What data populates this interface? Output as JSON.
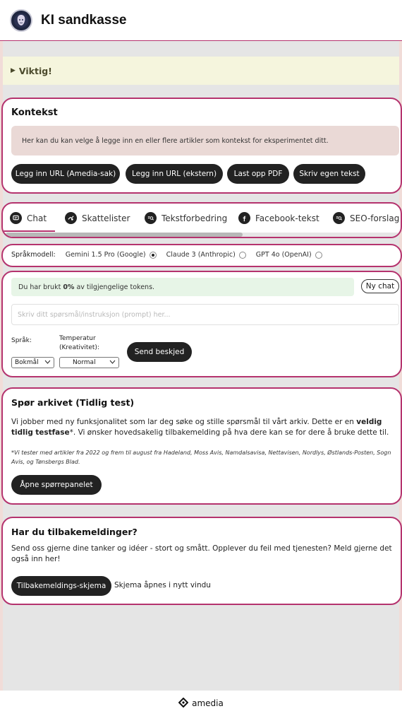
{
  "header": {
    "title": "KI sandkasse"
  },
  "notice": {
    "label": "Viktig!"
  },
  "context": {
    "title": "Kontekst",
    "info": "Her kan du kan velge å legge inn en eller flere artikler som kontekst for eksperimentet ditt.",
    "buttons": [
      "Legg inn URL (Amedia-sak)",
      "Legg inn URL (ekstern)",
      "Last opp PDF",
      "Skriv egen tekst"
    ]
  },
  "tabs": [
    "Chat",
    "Skattelister",
    "Tekstforbedring",
    "Facebook-tekst",
    "SEO-forslag"
  ],
  "model": {
    "label": "Språkmodell:",
    "options": [
      "Gemini 1.5 Pro (Google)",
      "Claude 3 (Anthropic)",
      "GPT 4o (OpenAI)"
    ],
    "selected": "Gemini 1.5 Pro (Google)"
  },
  "chat": {
    "tokens_prefix": "Du har brukt",
    "tokens_value": "0%",
    "tokens_suffix": "av tilgjengelige tokens.",
    "new_chat": "Ny chat",
    "prompt_placeholder": "Skriv ditt spørsmål/instruksjon (prompt) her...",
    "language_label": "Språk:",
    "language_value": "Bokmål",
    "temp_label_1": "Temperatur",
    "temp_label_2": "(Kreativitet):",
    "temp_value": "Normal",
    "send": "Send beskjed"
  },
  "archive": {
    "title": "Spør arkivet (Tidlig test)",
    "text_1": "Vi jobber med ny funksjonalitet som lar deg søke og stille spørsmål til vårt arkiv. Dette er en ",
    "text_bold_1": "veldig tidlig",
    "text_bold_2": "testfase",
    "text_2": "*. Vi ønsker hovedsakelig tilbakemelding på hva dere kan se for dere å bruke dette til.",
    "note": "*Vi tester med artikler fra 2022 og frem til august fra Hadeland, Moss Avis, Namdalsavisa, Nettavisen, Nordlys, Østlands-Posten, Sogn Avis, og Tønsbergs Blad.",
    "button": "Åpne spørrepanelet"
  },
  "feedback": {
    "title": "Har du tilbakemeldinger?",
    "text": "Send oss gjerne dine tanker og idéer - stort og smått. Opplever du feil med tjenesten? Meld gjerne det også inn her!",
    "button": "Tilbakemeldings-skjema",
    "hint": "Skjema åpnes i nytt vindu"
  },
  "footer": {
    "brand": "amedia"
  },
  "colors": {
    "accent": "#b5336e",
    "dark": "#222222",
    "notice_bg": "#f5f5dd",
    "info_bg": "#ead9d6",
    "tokens_bg": "#e7f5e7"
  },
  "icons": {
    "tabs": [
      "chat-bubble-icon",
      "money-hand-icon",
      "text-search-icon",
      "facebook-icon",
      "seo-search-icon"
    ]
  }
}
